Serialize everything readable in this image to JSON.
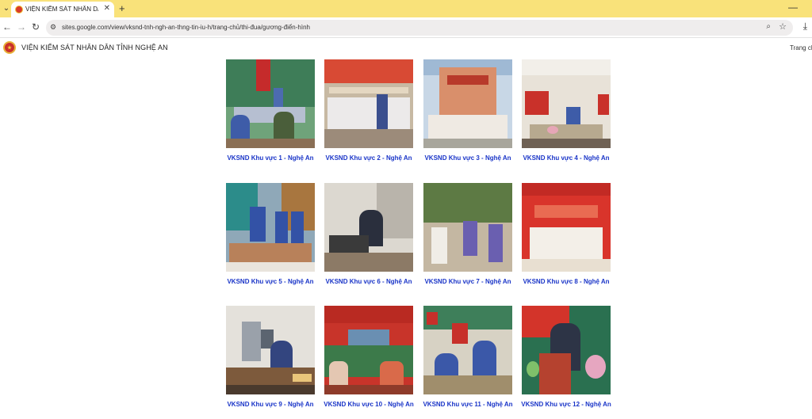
{
  "browser": {
    "tab_title": "VIỆN KIỂM SÁT NHÂN DÂN TỈN",
    "url": "sites.google.com/view/vksnd-tnh-ngh-an-thng-tin-iu-h/trang-chủ/thi-đua/gương-điển-hình",
    "icons": {
      "tab_menu": "chevron-down-icon",
      "close": "close-icon",
      "new_tab": "plus-icon",
      "minimize": "minimize-icon",
      "back": "back-arrow-icon",
      "forward": "forward-arrow-icon",
      "reload": "reload-icon",
      "site_info": "tune-icon",
      "zoom": "zoom-icon",
      "bookmark": "star-icon",
      "download": "download-icon"
    }
  },
  "site": {
    "title": "VIỆN KIỂM SÁT NHÂN DÂN TỈNH NGHỆ AN",
    "nav_home": "Trang ch",
    "logo": "emblem-logo"
  },
  "cards": [
    {
      "caption": "VKSND Khu vực 1 - Nghệ An"
    },
    {
      "caption": "VKSND Khu vực 2 - Nghệ An"
    },
    {
      "caption": "VKSND Khu vực 3 - Nghệ An"
    },
    {
      "caption": "VKSND Khu vực 4 - Nghệ An"
    },
    {
      "caption": "VKSND Khu vực 5 - Nghệ An"
    },
    {
      "caption": "VKSND Khu vực 6 - Nghệ An"
    },
    {
      "caption": "VKSND Khu vực 7 - Nghệ An"
    },
    {
      "caption": "VKSND Khu vực 8 - Nghệ An"
    },
    {
      "caption": "VKSND Khu vực 9 - Nghệ An"
    },
    {
      "caption": "VKSND Khu vực 10 - Nghệ An"
    },
    {
      "caption": "VKSND Khu vực 11 - Nghệ An"
    },
    {
      "caption": "VKSND Khu vực 12 - Nghệ An"
    }
  ],
  "colors": {
    "tab_strip": "#f9e27a",
    "caption_link": "#1a35c8"
  }
}
